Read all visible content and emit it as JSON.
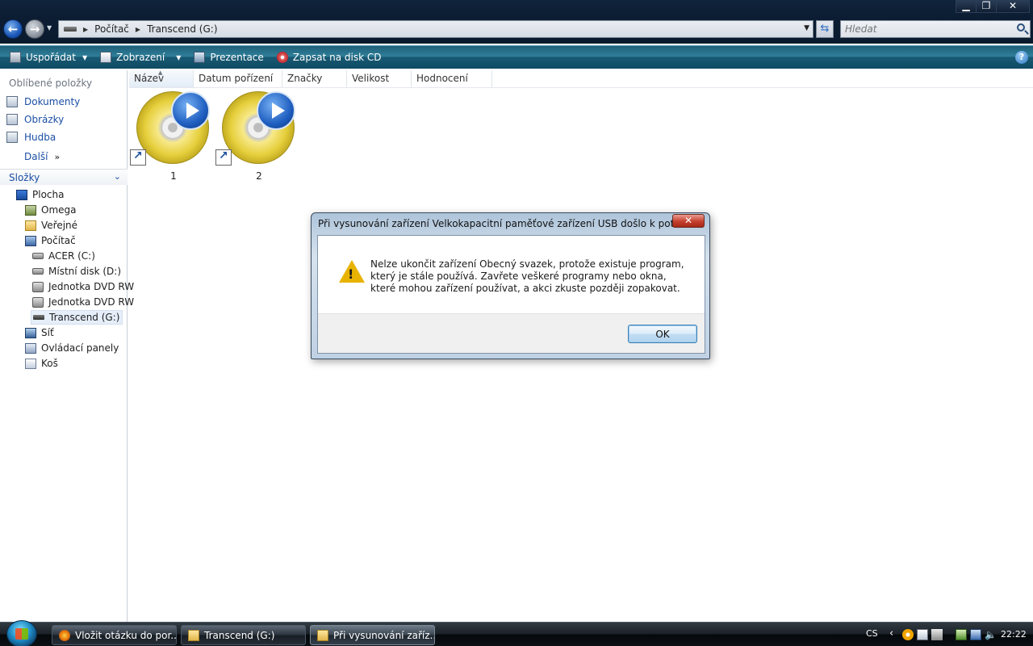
{
  "window": {
    "minimize_label": "▁",
    "maximize_label": "❐",
    "close_label": "✕"
  },
  "address": {
    "crumbs": [
      "Počítač",
      "Transcend (G:)"
    ]
  },
  "search": {
    "placeholder": "Hledat"
  },
  "toolbar": {
    "organize": "Uspořádat",
    "views": "Zobrazení",
    "slideshow": "Prezentace",
    "burn": "Zapsat na disk CD",
    "help": "?"
  },
  "navpane": {
    "favorites_title": "Oblíbené položky",
    "favorites": [
      "Dokumenty",
      "Obrázky",
      "Hudba"
    ],
    "more": "Další",
    "more_chevron": "»",
    "folders_title": "Složky",
    "tree": [
      {
        "label": "Plocha",
        "icon": "desktop-icon"
      },
      {
        "label": "Omega",
        "icon": "user-folder-icon"
      },
      {
        "label": "Veřejné",
        "icon": "public-folder-icon"
      },
      {
        "label": "Počítač",
        "icon": "computer-icon"
      },
      {
        "label": "ACER (C:)",
        "icon": "windows-drive-icon"
      },
      {
        "label": "Místní disk (D:)",
        "icon": "hard-drive-icon"
      },
      {
        "label": "Jednotka DVD RW",
        "icon": "dvd-drive-icon"
      },
      {
        "label": "Jednotka DVD RW",
        "icon": "dvd-drive-icon"
      },
      {
        "label": "Transcend (G:)",
        "icon": "usb-drive-icon"
      },
      {
        "label": "Síť",
        "icon": "network-icon"
      },
      {
        "label": "Ovládací panely",
        "icon": "control-panel-icon"
      },
      {
        "label": "Koš",
        "icon": "recycle-bin-icon"
      }
    ]
  },
  "columns": [
    "Název",
    "Datum pořízení",
    "Značky",
    "Velikost",
    "Hodnocení"
  ],
  "files": [
    {
      "name": "1",
      "icon": "dvd-video-shortcut-icon"
    },
    {
      "name": "2",
      "icon": "dvd-video-shortcut-icon"
    }
  ],
  "dialog": {
    "title": "Při vysunování zařízení Velkokapacitní paměťové zařízení USB došlo k potížím.",
    "close_label": "✕",
    "icon": "warning-icon",
    "message": "Nelze ukončit zařízení Obecný svazek, protože existuje program, který je stále používá. Zavřete veškeré programy nebo okna, které mohou zařízení používat, a akci zkuste později zopakovat.",
    "ok_label": "OK"
  },
  "taskbar": {
    "buttons": [
      {
        "label": "Vložit otázku do por...",
        "icon": "firefox-icon"
      },
      {
        "label": "Transcend (G:)",
        "icon": "folder-icon"
      },
      {
        "label": "Při vysunování zaříz...",
        "icon": "folder-icon"
      }
    ],
    "language": "CS",
    "tray_chevron": "‹",
    "clock": "22:22"
  },
  "colors": {
    "accent": "#1a4ea3",
    "command_bar": "#2f7f99",
    "warning": "#e8b300"
  }
}
